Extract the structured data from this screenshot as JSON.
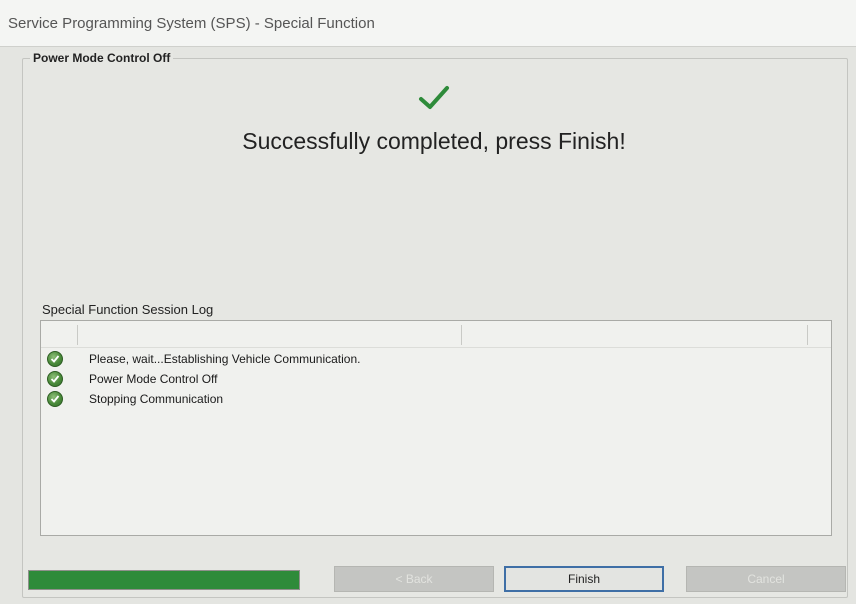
{
  "window": {
    "title": "Service Programming System (SPS) - Special Function"
  },
  "group": {
    "title": "Power Mode Control Off"
  },
  "status": {
    "icon": "checkmark-icon",
    "color": "#2e8b3a",
    "message": "Successfully completed, press Finish!"
  },
  "log": {
    "label": "Special Function Session Log",
    "entries": [
      {
        "icon": "success-icon",
        "text": "Please, wait...Establishing Vehicle Communication."
      },
      {
        "icon": "success-icon",
        "text": "Power Mode Control Off"
      },
      {
        "icon": "success-icon",
        "text": "Stopping Communication"
      }
    ]
  },
  "progress": {
    "percent": 100,
    "color": "#2e8b3a"
  },
  "buttons": {
    "back": "< Back",
    "finish": "Finish",
    "cancel": "Cancel"
  }
}
